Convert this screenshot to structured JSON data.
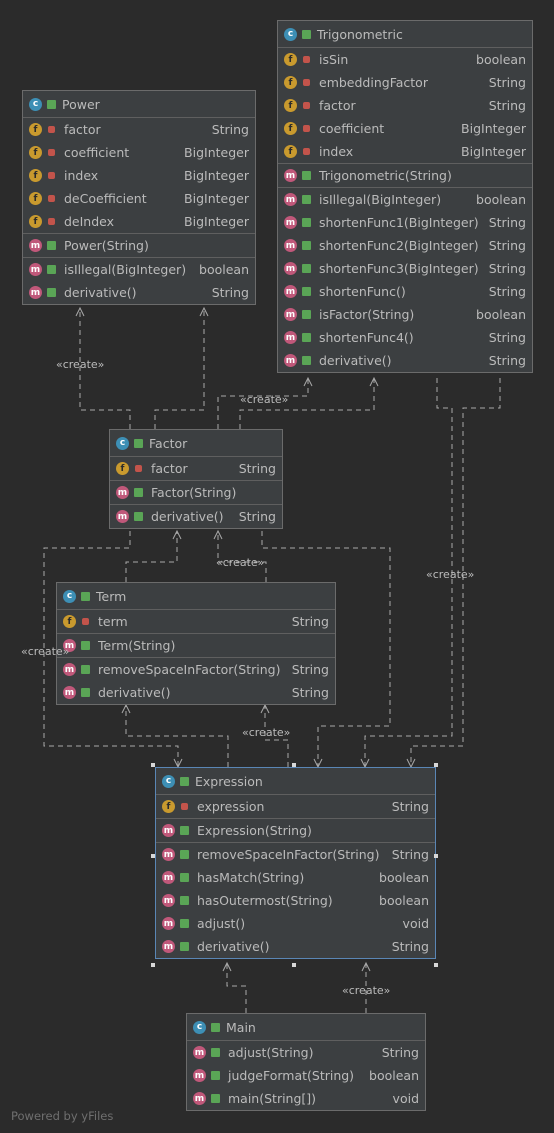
{
  "diagram": {
    "classes": [
      {
        "id": "power",
        "name": "Power",
        "sections": [
          [
            {
              "kind": "f",
              "vis": "private",
              "name": "factor",
              "type": "String"
            },
            {
              "kind": "f",
              "vis": "private",
              "name": "coefficient",
              "type": "BigInteger"
            },
            {
              "kind": "f",
              "vis": "private",
              "name": "index",
              "type": "BigInteger"
            },
            {
              "kind": "f",
              "vis": "private",
              "name": "deCoefficient",
              "type": "BigInteger"
            },
            {
              "kind": "f",
              "vis": "private",
              "name": "deIndex",
              "type": "BigInteger"
            }
          ],
          [
            {
              "kind": "m",
              "vis": "public",
              "name": "Power(String)",
              "type": ""
            }
          ],
          [
            {
              "kind": "m",
              "vis": "public",
              "name": "isIllegal(BigInteger)",
              "type": "boolean"
            },
            {
              "kind": "m",
              "vis": "public",
              "name": "derivative()",
              "type": "String"
            }
          ]
        ]
      },
      {
        "id": "trigonometric",
        "name": "Trigonometric",
        "sections": [
          [
            {
              "kind": "f",
              "vis": "private",
              "name": "isSin",
              "type": "boolean"
            },
            {
              "kind": "f",
              "vis": "private",
              "name": "embeddingFactor",
              "type": "String"
            },
            {
              "kind": "f",
              "vis": "private",
              "name": "factor",
              "type": "String"
            },
            {
              "kind": "f",
              "vis": "private",
              "name": "coefficient",
              "type": "BigInteger"
            },
            {
              "kind": "f",
              "vis": "private",
              "name": "index",
              "type": "BigInteger"
            }
          ],
          [
            {
              "kind": "m",
              "vis": "public",
              "name": "Trigonometric(String)",
              "type": ""
            }
          ],
          [
            {
              "kind": "m",
              "vis": "public",
              "name": "isIllegal(BigInteger)",
              "type": "boolean"
            },
            {
              "kind": "m",
              "vis": "public",
              "name": "shortenFunc1(BigInteger)",
              "type": "String"
            },
            {
              "kind": "m",
              "vis": "public",
              "name": "shortenFunc2(BigInteger)",
              "type": "String"
            },
            {
              "kind": "m",
              "vis": "public",
              "name": "shortenFunc3(BigInteger)",
              "type": "String"
            },
            {
              "kind": "m",
              "vis": "public",
              "name": "shortenFunc()",
              "type": "String"
            },
            {
              "kind": "m",
              "vis": "public",
              "name": "isFactor(String)",
              "type": "boolean"
            },
            {
              "kind": "m",
              "vis": "public",
              "name": "shortenFunc4()",
              "type": "String"
            },
            {
              "kind": "m",
              "vis": "public",
              "name": "derivative()",
              "type": "String"
            }
          ]
        ]
      },
      {
        "id": "factor",
        "name": "Factor",
        "sections": [
          [
            {
              "kind": "f",
              "vis": "private",
              "name": "factor",
              "type": "String"
            }
          ],
          [
            {
              "kind": "m",
              "vis": "public",
              "name": "Factor(String)",
              "type": ""
            }
          ],
          [
            {
              "kind": "m",
              "vis": "public",
              "name": "derivative()",
              "type": "String"
            }
          ]
        ]
      },
      {
        "id": "term",
        "name": "Term",
        "sections": [
          [
            {
              "kind": "f",
              "vis": "private",
              "name": "term",
              "type": "String"
            }
          ],
          [
            {
              "kind": "m",
              "vis": "public",
              "name": "Term(String)",
              "type": ""
            }
          ],
          [
            {
              "kind": "m",
              "vis": "public",
              "name": "removeSpaceInFactor(String)",
              "type": "String"
            },
            {
              "kind": "m",
              "vis": "public",
              "name": "derivative()",
              "type": "String"
            }
          ]
        ]
      },
      {
        "id": "expression",
        "name": "Expression",
        "selected": true,
        "sections": [
          [
            {
              "kind": "f",
              "vis": "private",
              "name": "expression",
              "type": "String"
            }
          ],
          [
            {
              "kind": "m",
              "vis": "public",
              "name": "Expression(String)",
              "type": ""
            }
          ],
          [
            {
              "kind": "m",
              "vis": "public",
              "name": "removeSpaceInFactor(String)",
              "type": "String"
            },
            {
              "kind": "m",
              "vis": "public",
              "name": "hasMatch(String)",
              "type": "boolean"
            },
            {
              "kind": "m",
              "vis": "public",
              "name": "hasOutermost(String)",
              "type": "boolean"
            },
            {
              "kind": "m",
              "vis": "public",
              "name": "adjust()",
              "type": "void"
            },
            {
              "kind": "m",
              "vis": "public",
              "name": "derivative()",
              "type": "String"
            }
          ]
        ]
      },
      {
        "id": "main",
        "name": "Main",
        "sections": [
          [
            {
              "kind": "m",
              "vis": "public",
              "name": "adjust(String)",
              "type": "String"
            },
            {
              "kind": "m",
              "vis": "public",
              "name": "judgeFormat(String)",
              "type": "boolean"
            },
            {
              "kind": "m",
              "vis": "public",
              "name": "main(String[])",
              "type": "void"
            }
          ]
        ]
      }
    ],
    "stereotype": "«create»",
    "colors": {
      "background": "#2b2b2b",
      "node": "#3c3f41",
      "edge": "#a9a9a9",
      "text": "#bbbbbb",
      "class_badge": "#3d8fb5",
      "field_badge": "#c99a2e",
      "method_badge": "#c0587a",
      "private": "#c3544b",
      "public": "#5aa556"
    }
  },
  "footer": "Powered by yFiles"
}
